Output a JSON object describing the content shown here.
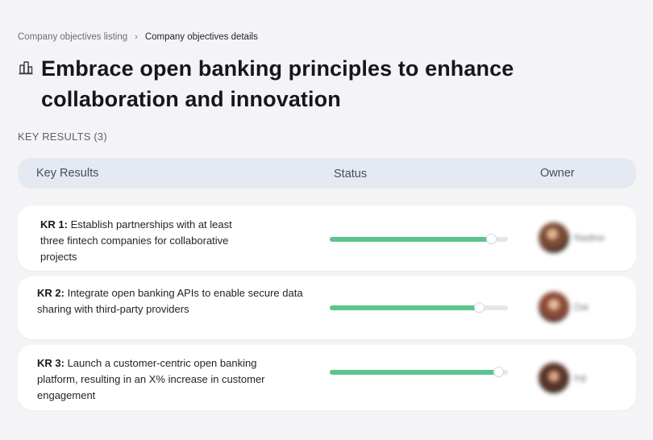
{
  "breadcrumb": {
    "parent": "Company objectives listing",
    "separator": "›",
    "current": "Company objectives details"
  },
  "objective": {
    "title": "Embrace open banking principles to enhance collaboration and innovation",
    "icon": "building-icon"
  },
  "key_results": {
    "section_label": "KEY RESULTS (3)",
    "columns": {
      "key_results": "Key Results",
      "status": "Status",
      "owner": "Owner"
    },
    "rows": [
      {
        "id": "KR 1:",
        "text": "Establish partnerships with at least three fintech companies for collaborative projects",
        "progress": 0.91,
        "owner_name": "Nadine"
      },
      {
        "id": "KR 2:",
        "text": "Integrate open banking APIs to enable secure data sharing with third-party providers",
        "progress": 0.84,
        "owner_name": "Dai"
      },
      {
        "id": "KR 3:",
        "text": "Launch a customer-centric open banking platform, resulting in an X% increase in customer engagement",
        "progress": 0.95,
        "owner_name": "Inji"
      }
    ]
  },
  "colors": {
    "background": "#f4f4f6",
    "header_bg": "#e5eaf2",
    "progress_fill": "#5cc48c",
    "progress_track": "#e6e7ea"
  }
}
